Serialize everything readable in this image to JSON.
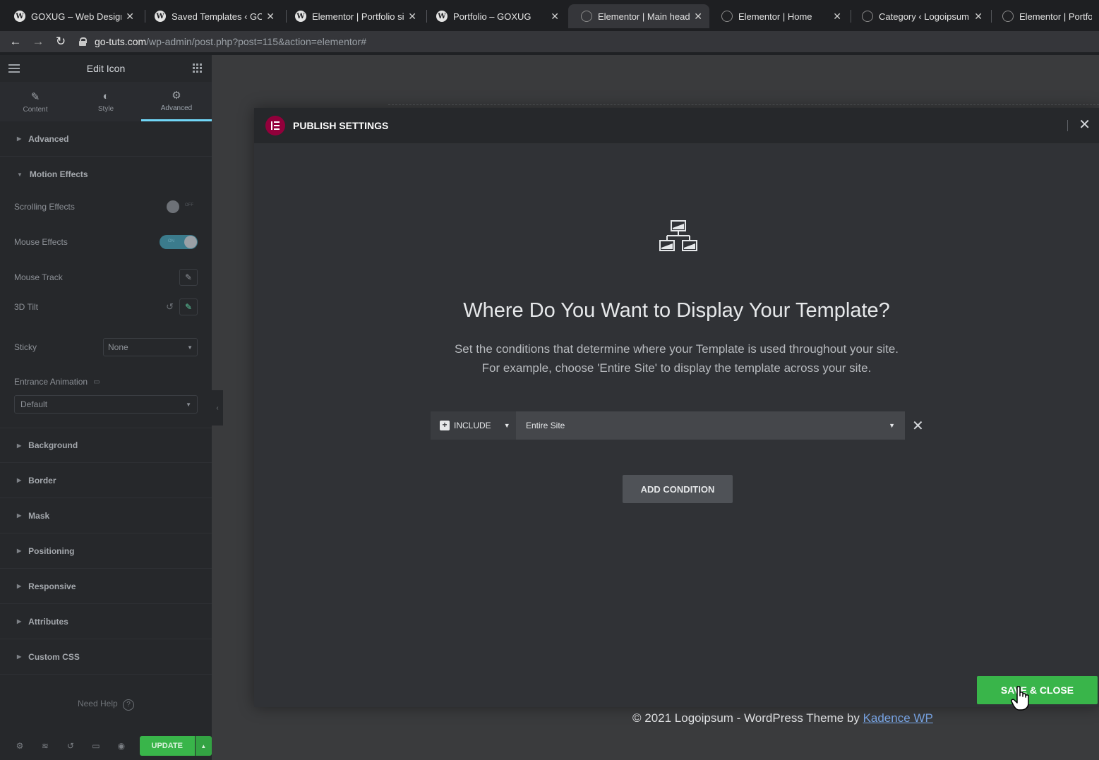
{
  "browser": {
    "tabs": [
      {
        "title": "GOXUG – Web Design F",
        "icon": "wordpress-icon",
        "active": false
      },
      {
        "title": "Saved Templates ‹ GOX",
        "icon": "wordpress-icon",
        "active": false
      },
      {
        "title": "Elementor | Portfolio si",
        "icon": "wordpress-icon",
        "active": false
      },
      {
        "title": "Portfolio – GOXUG",
        "icon": "wordpress-icon",
        "active": false
      },
      {
        "title": "Elementor | Main heade",
        "icon": "globe-icon",
        "active": true
      },
      {
        "title": "Elementor | Home",
        "icon": "globe-icon",
        "active": false
      },
      {
        "title": "Category ‹ Logoipsum -",
        "icon": "globe-icon",
        "active": false
      },
      {
        "title": "Elementor | Portfolio",
        "icon": "globe-icon",
        "active": false
      }
    ],
    "url_domain": "go-tuts.com",
    "url_path": "/wp-admin/post.php?post=115&action=elementor#"
  },
  "panel": {
    "title": "Edit Icon",
    "tabs": [
      {
        "label": "Content",
        "icon": "pencil-icon"
      },
      {
        "label": "Style",
        "icon": "half-circle-icon"
      },
      {
        "label": "Advanced",
        "icon": "gear-icon"
      }
    ],
    "active_tab": "Advanced",
    "sections_top": [
      {
        "label": "Advanced",
        "expanded": false
      },
      {
        "label": "Motion Effects",
        "expanded": true
      }
    ],
    "controls": {
      "scrolling_effects": {
        "label": "Scrolling Effects",
        "state": "OFF"
      },
      "mouse_effects": {
        "label": "Mouse Effects",
        "state": "ON"
      },
      "mouse_track": {
        "label": "Mouse Track"
      },
      "tilt_3d": {
        "label": "3D Tilt"
      },
      "sticky": {
        "label": "Sticky",
        "value": "None"
      },
      "entrance_animation": {
        "label": "Entrance Animation",
        "value": "Default"
      }
    },
    "sections_bottom": [
      {
        "label": "Background"
      },
      {
        "label": "Border"
      },
      {
        "label": "Mask"
      },
      {
        "label": "Positioning"
      },
      {
        "label": "Responsive"
      },
      {
        "label": "Attributes"
      },
      {
        "label": "Custom CSS"
      }
    ],
    "need_help": "Need Help",
    "update_label": "UPDATE"
  },
  "modal": {
    "title": "PUBLISH SETTINGS",
    "heading": "Where Do You Want to Display Your Template?",
    "description_line1": "Set the conditions that determine where your Template is used throughout your site.",
    "description_line2": "For example, choose 'Entire Site' to display the template across your site.",
    "condition": {
      "type": "INCLUDE",
      "value": "Entire Site"
    },
    "add_condition_label": "ADD CONDITION",
    "save_close_label": "SAVE & CLOSE"
  },
  "canvas": {
    "footer_text": "© 2021 Logoipsum - WordPress Theme by ",
    "footer_link": "Kadence WP"
  },
  "colors": {
    "accent_green": "#39b54a",
    "elementor_brand": "#92003b",
    "active_tab_underline": "#71d7f7"
  }
}
